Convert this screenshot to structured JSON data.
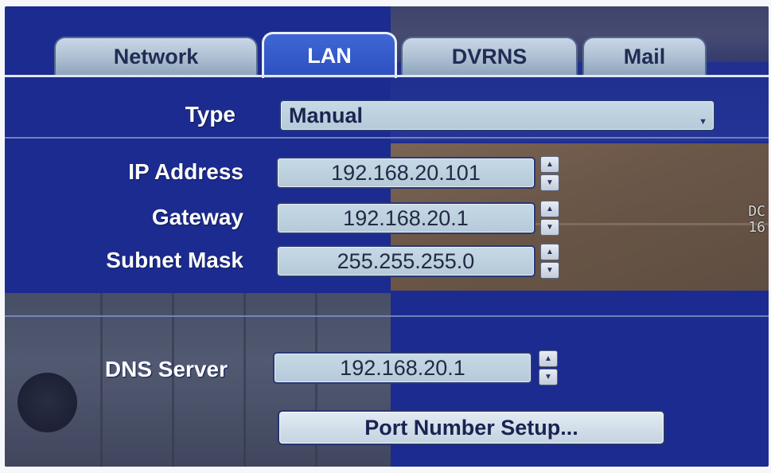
{
  "tabs": [
    "Network",
    "LAN",
    "DVRNS",
    "Mail"
  ],
  "active_tab": "LAN",
  "type": {
    "label": "Type",
    "value": "Manual"
  },
  "ip_address": {
    "label": "IP Address",
    "value": "192.168.20.101"
  },
  "gateway": {
    "label": "Gateway",
    "value": "192.168.20.1"
  },
  "subnet_mask": {
    "label": "Subnet Mask",
    "value": "255.255.255.0"
  },
  "dns_server": {
    "label": "DNS Server",
    "value": "192.168.20.1"
  },
  "port_setup_button": "Port Number Setup...",
  "camera_overlay": [
    "DC",
    "16"
  ],
  "colors": {
    "panel": "#1b2b8f",
    "tab_active": "#2c4fc0",
    "field": "#c6d9e6"
  }
}
